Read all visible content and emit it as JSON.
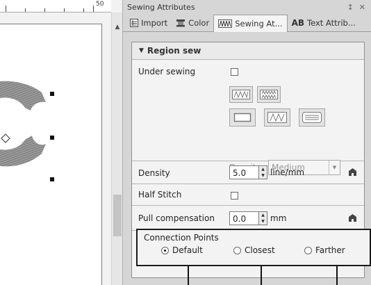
{
  "ruler": {
    "label": "50"
  },
  "panel": {
    "title": "Sewing Attributes",
    "pin_icon": "pin-icon",
    "close_icon": "close-icon"
  },
  "tabs": [
    {
      "label": "Import",
      "icon": "import-icon"
    },
    {
      "label": "Color",
      "icon": "color-icon"
    },
    {
      "label": "Sewing At...",
      "icon": "sewing-icon",
      "active": true
    },
    {
      "label": "Text Attrib...",
      "icon": "text-attributes-icon",
      "icon_text": "AB"
    }
  ],
  "section": {
    "title": "Region sew"
  },
  "under_sewing": {
    "label": "Under sewing",
    "checked": false,
    "density_label": "Density",
    "density_value": "Medium"
  },
  "density": {
    "label": "Density",
    "value": "5.0",
    "unit": "line/mm"
  },
  "half_stitch": {
    "label": "Half Stitch",
    "checked": false
  },
  "pull_compensation": {
    "label": "Pull compensation",
    "value": "0.0",
    "unit": "mm"
  },
  "connection_points": {
    "title": "Connection Points",
    "options": [
      {
        "label": "Default",
        "selected": true
      },
      {
        "label": "Closest",
        "selected": false
      },
      {
        "label": "Farther",
        "selected": false
      }
    ]
  },
  "colors": {
    "panel_bg": "#d6d6d6",
    "content_bg": "#f3f3f3",
    "highlight_border": "#1a1a1a"
  }
}
